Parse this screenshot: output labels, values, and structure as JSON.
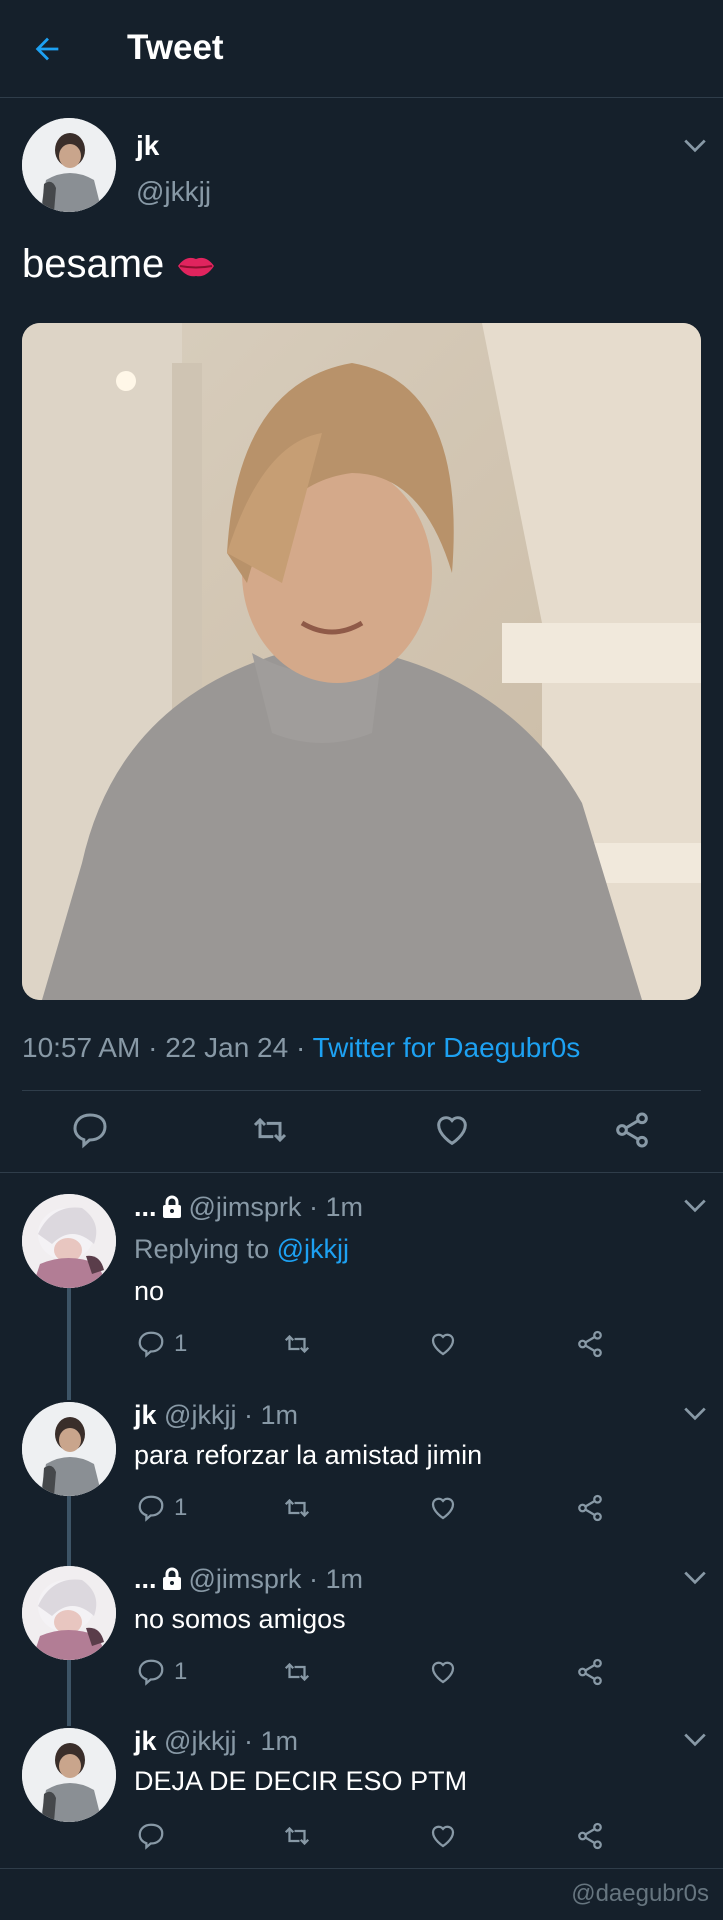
{
  "header": {
    "title": "Tweet"
  },
  "tweet": {
    "name": "jk",
    "handle": "@jkkjj",
    "text": "besame",
    "time": "10:57 AM",
    "date": "22 Jan 24",
    "sep": "·",
    "source": "Twitter for Daegubr0s"
  },
  "replies": [
    {
      "name": "...",
      "handle": "@jimsprk",
      "time": "1m",
      "replying_label": "Replying to",
      "replying_to": "@jkkjj",
      "text": "no",
      "reply_count": "1"
    },
    {
      "name": "jk",
      "handle": "@jkkjj",
      "time": "1m",
      "text": "para reforzar la amistad jimin",
      "reply_count": "1"
    },
    {
      "name": "...",
      "handle": "@jimsprk",
      "time": "1m",
      "text": "no somos amigos",
      "reply_count": "1"
    },
    {
      "name": "jk",
      "handle": "@jkkjj",
      "time": "1m",
      "text": "DEJA DE DECIR ESO PTM"
    }
  ],
  "watermark": "@daegubr0s",
  "colors": {
    "background": "#15202b",
    "accent": "#1da1f2",
    "muted": "#8899a6",
    "divider": "#2f3d4a"
  },
  "icons": [
    "back-arrow-icon",
    "chevron-down-icon",
    "reply-icon",
    "retweet-icon",
    "like-icon",
    "share-icon",
    "lock-icon",
    "lips-emoji-icon"
  ]
}
